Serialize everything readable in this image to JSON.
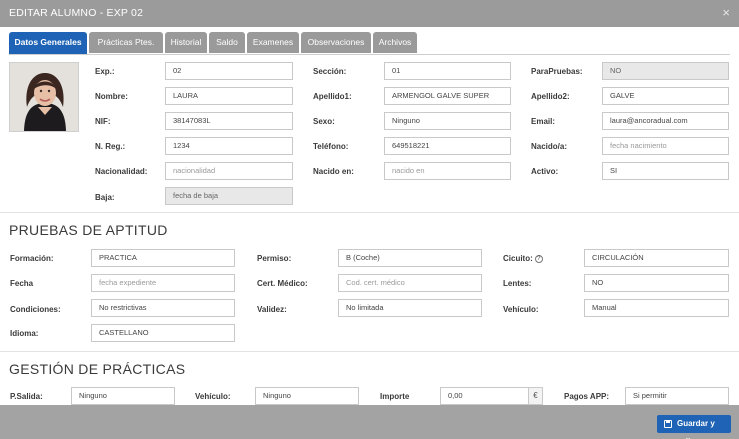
{
  "window": {
    "title": "EDITAR ALUMNO - EXP 02",
    "close_icon": "×"
  },
  "tabs": [
    "Datos Generales",
    "Prácticas Ptes.",
    "Historial",
    "Saldo",
    "Examenes",
    "Observaciones",
    "Archivos"
  ],
  "general": {
    "exp_label": "Exp.:",
    "exp_value": "02",
    "seccion_label": "Sección:",
    "seccion_value": "01",
    "parapruebas_label": "ParaPruebas:",
    "parapruebas_value": "NO",
    "nombre_label": "Nombre:",
    "nombre_value": "LAURA",
    "apellido1_label": "Apellido1:",
    "apellido1_value": "ARMENGOL GALVE SUPER",
    "apellido2_label": "Apellido2:",
    "apellido2_value": "GALVE",
    "nif_label": "NIF:",
    "nif_value": "38147083L",
    "sexo_label": "Sexo:",
    "sexo_value": "Ninguno",
    "email_label": "Email:",
    "email_value": "laura@ancoradual.com",
    "nreg_label": "N. Reg.:",
    "nreg_value": "1234",
    "telefono_label": "Teléfono:",
    "telefono_value": "649518221",
    "nacido_label": "Nacido/a:",
    "nacido_placeholder": "fecha nacimiento",
    "nacionalidad_label": "Nacionalidad:",
    "nacionalidad_placeholder": "nacionalidad",
    "nacidoen_label": "Nacido en:",
    "nacidoen_placeholder": "nacido en",
    "activo_label": "Activo:",
    "activo_value": "SI",
    "baja_label": "Baja:",
    "baja_placeholder": "fecha de baja"
  },
  "aptitud": {
    "title": "PRUEBAS DE APTITUD",
    "formacion_label": "Formación:",
    "formacion_value": "PRACTICA",
    "permiso_label": "Permiso:",
    "permiso_value": "B (Coche)",
    "circuito_label": "Cicuito:",
    "circuito_value": "CIRCULACIÓN",
    "fecha_label": "Fecha",
    "fecha_placeholder": "fecha expediente",
    "certmedico_label": "Cert. Médico:",
    "certmedico_placeholder": "Cod. cert. médico",
    "lentes_label": "Lentes:",
    "lentes_value": "NO",
    "condiciones_label": "Condiciones:",
    "condiciones_value": "No restrictivas",
    "validez_label": "Validez:",
    "validez_value": "No limitada",
    "vehiculo_label": "Vehículo:",
    "vehiculo_value": "Manual",
    "idioma_label": "Idioma:",
    "idioma_value": "CASTELLANO"
  },
  "practicas": {
    "title": "GESTIÓN DE PRÁCTICAS",
    "psalida_label": "P.Salida:",
    "psalida_value": "Ninguno",
    "vehiculo_label": "Vehículo:",
    "vehiculo_value": "Ninguno",
    "importe_label": "Importe",
    "importe_value": "0,00",
    "currency": "€",
    "pagosapp_label": "Pagos APP:",
    "pagosapp_value": "Si permitir"
  },
  "footer": {
    "save_label": "Guardar y salir"
  },
  "colors": {
    "accent": "#1e63b5",
    "titlebar": "#9b9b9b",
    "tab_inactive": "#9a9a9a"
  }
}
